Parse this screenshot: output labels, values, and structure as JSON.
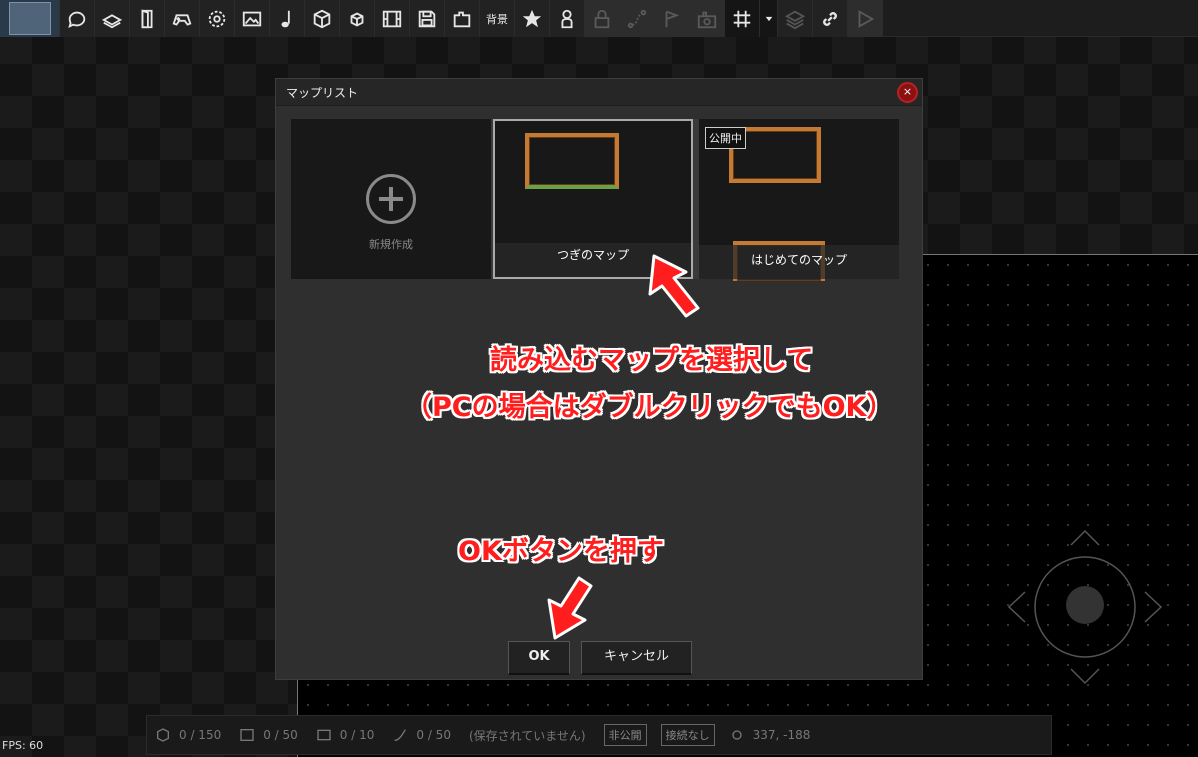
{
  "toolbar": {
    "items": [
      "speech-bubble-icon",
      "book-icon",
      "door-icon",
      "gamepad-icon",
      "gear-icon",
      "image-icon",
      "music-note-icon",
      "cube-icon",
      "small-cube-icon",
      "film-icon",
      "save-icon",
      "plugin-icon",
      "background",
      "star-icon",
      "person-icon",
      "lock-icon",
      "path-icon",
      "flag-icon",
      "camera-icon",
      "grid-icon",
      "dropdown-icon",
      "layers-icon",
      "link-icon",
      "play-icon"
    ],
    "background_label": "背景"
  },
  "dialog": {
    "title": "マップリスト",
    "close_label": "×",
    "new_map_label": "新規作成",
    "maps": [
      {
        "name": "つぎのマップ",
        "selected": true,
        "published": false
      },
      {
        "name": "はじめてのマップ",
        "selected": false,
        "published": true,
        "badge": "公開中"
      }
    ],
    "ok_label": "OK",
    "cancel_label": "キャンセル"
  },
  "annotations": {
    "line1": "読み込むマップを選択して",
    "line2": "（PCの場合はダブルクリックでもOK）",
    "line3": "OKボタンを押す"
  },
  "status": {
    "fps": "FPS: 60",
    "objects": "0 / 150",
    "scenes": "0 / 50",
    "images": "0 / 10",
    "items": "0 / 50",
    "save_state": "(保存されていません)",
    "public_state": "非公開",
    "connection": "接続なし",
    "coords": "337, -188"
  },
  "colors": {
    "accent_red": "#ff1d1d",
    "map_frame": "#c27a35",
    "close_button": "#8c1010"
  }
}
